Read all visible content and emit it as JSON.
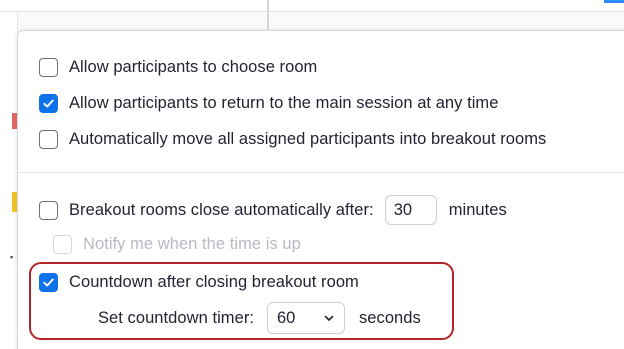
{
  "options": {
    "choose_room": {
      "label": "Allow participants to choose room",
      "checked": false
    },
    "return_main": {
      "label": "Allow participants to return to the main session at any time",
      "checked": true
    },
    "auto_move": {
      "label": "Automatically move all assigned participants into breakout rooms",
      "checked": false
    },
    "close_auto": {
      "label": "Breakout rooms close automatically after:",
      "checked": false,
      "value": "30",
      "unit": "minutes"
    },
    "notify": {
      "label": "Notify me when the time is up",
      "checked": false,
      "disabled": true
    },
    "countdown": {
      "label": "Countdown after closing breakout room",
      "checked": true
    },
    "timer": {
      "label": "Set countdown timer:",
      "value": "60",
      "unit": "seconds"
    }
  },
  "colors": {
    "accent": "#0e72ed",
    "highlight": "#b3232b",
    "text": "#232333",
    "disabled_text": "#b9b9c4"
  },
  "icons": {
    "check": "check-icon",
    "dropdown": "chevron-down-icon"
  }
}
